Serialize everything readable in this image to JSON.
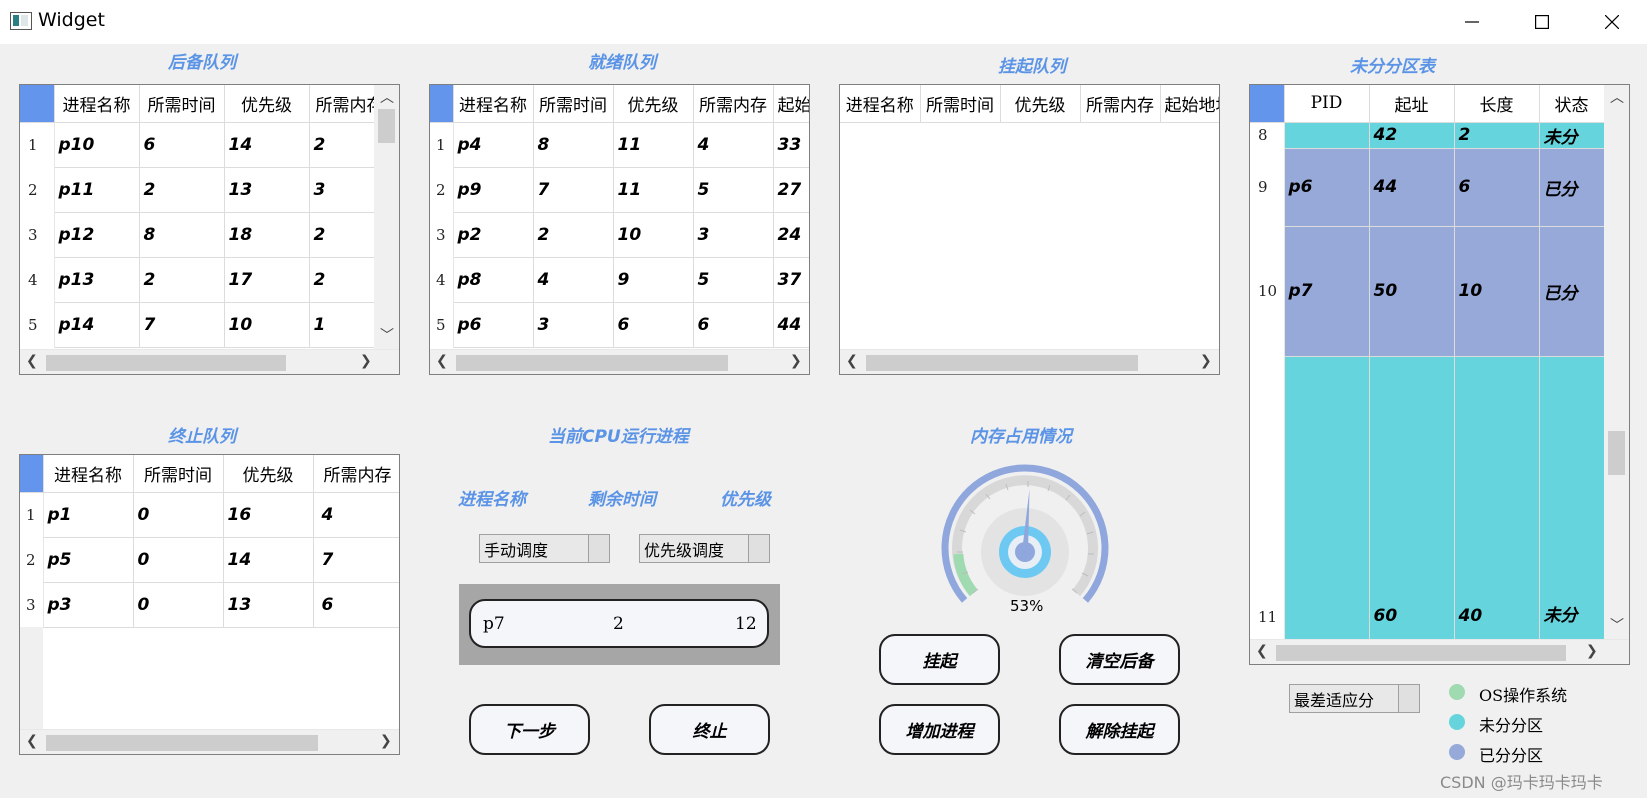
{
  "window": {
    "title": "Widget"
  },
  "backup_queue": {
    "title": "后备队列",
    "columns": [
      "进程名称",
      "所需时间",
      "优先级",
      "所需内存"
    ],
    "row_numbers": [
      "1",
      "2",
      "3",
      "4",
      "5"
    ],
    "rows": [
      [
        "p10",
        "6",
        "14",
        "2"
      ],
      [
        "p11",
        "2",
        "13",
        "3"
      ],
      [
        "p12",
        "8",
        "18",
        "2"
      ],
      [
        "p13",
        "2",
        "17",
        "2"
      ],
      [
        "p14",
        "7",
        "10",
        "1"
      ]
    ]
  },
  "ready_queue": {
    "title": "就绪队列",
    "columns": [
      "进程名称",
      "所需时间",
      "优先级",
      "所需内存",
      "起始地址"
    ],
    "row_numbers": [
      "1",
      "2",
      "3",
      "4",
      "5"
    ],
    "rows": [
      [
        "p4",
        "8",
        "11",
        "4",
        "33"
      ],
      [
        "p9",
        "7",
        "11",
        "5",
        "27"
      ],
      [
        "p2",
        "2",
        "10",
        "3",
        "24"
      ],
      [
        "p8",
        "4",
        "9",
        "5",
        "37"
      ],
      [
        "p6",
        "3",
        "6",
        "6",
        "44"
      ]
    ]
  },
  "suspend_queue": {
    "title": "挂起队列",
    "columns": [
      "进程名称",
      "所需时间",
      "优先级",
      "所需内存",
      "起始地址"
    ]
  },
  "partition_table": {
    "title": "未分分区表",
    "columns": [
      "PID",
      "起址",
      "长度",
      "状态"
    ],
    "row_numbers": [
      "8",
      "9",
      "10",
      "11"
    ],
    "rows": [
      [
        "",
        "42",
        "2",
        "未分"
      ],
      [
        "p6",
        "44",
        "6",
        "已分"
      ],
      [
        "p7",
        "50",
        "10",
        "已分"
      ],
      [
        "",
        "60",
        "40",
        "未分"
      ]
    ]
  },
  "terminated_queue": {
    "title": "终止队列",
    "columns": [
      "进程名称",
      "所需时间",
      "优先级",
      "所需内存"
    ],
    "row_numbers": [
      "1",
      "2",
      "3"
    ],
    "rows": [
      [
        "p1",
        "0",
        "16",
        "4"
      ],
      [
        "p5",
        "0",
        "14",
        "7"
      ],
      [
        "p3",
        "0",
        "13",
        "6"
      ]
    ]
  },
  "cpu": {
    "title": "当前CPU运行进程",
    "labels": [
      "进程名称",
      "剩余时间",
      "优先级"
    ],
    "schedule_mode": "手动调度",
    "algorithm": "优先级调度",
    "running": {
      "name": "p7",
      "remaining": "2",
      "priority": "12"
    },
    "next_button": "下一步",
    "terminate_button": "终止"
  },
  "memory": {
    "title": "内存占用情况",
    "usage_percent": 53,
    "usage_text": "53%",
    "buttons": {
      "suspend": "挂起",
      "clear_backup": "清空后备",
      "add_process": "增加进程",
      "release": "解除挂起"
    },
    "fit_algorithm": "最差适应分",
    "legend": [
      {
        "label": "OS操作系统",
        "color": "#9fdab0"
      },
      {
        "label": "未分分区",
        "color": "#66d4dc"
      },
      {
        "label": "已分分区",
        "color": "#97a9d8"
      }
    ]
  },
  "colors": {
    "unallocated": "#66d4dc",
    "allocated": "#97a9d8",
    "accent": "#5b94e6",
    "corner": "#6495ed"
  },
  "watermark": "CSDN @玛卡玛卡玛卡"
}
